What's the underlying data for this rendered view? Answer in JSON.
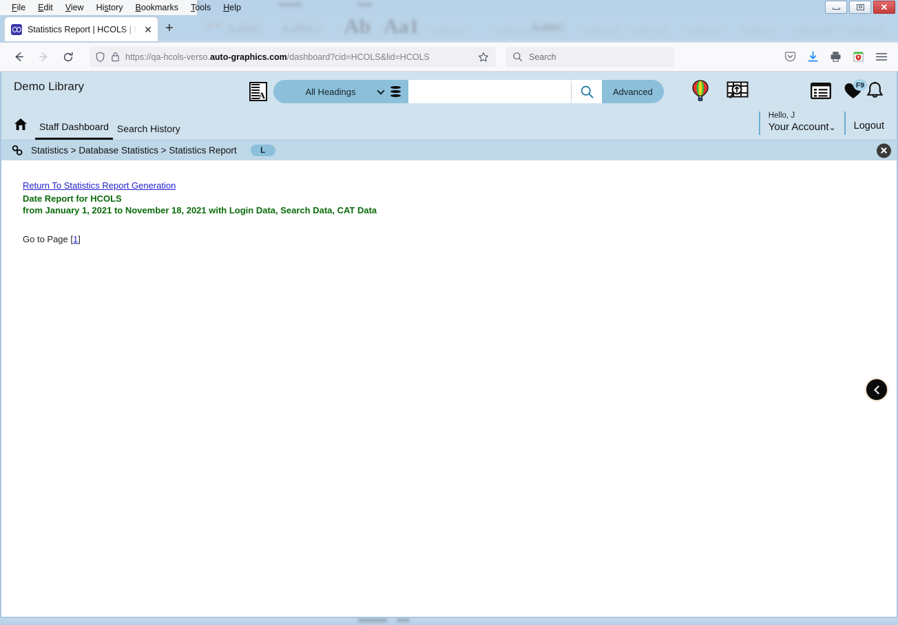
{
  "window": {
    "menus": [
      "File",
      "Edit",
      "View",
      "History",
      "Bookmarks",
      "Tools",
      "Help"
    ],
    "minimize_label": "–",
    "maximize_label": "□",
    "close_label": "✕"
  },
  "browser": {
    "tab": {
      "title": "Statistics Report | HCOLS | hcols",
      "favicon": "hcols-favicon",
      "close_label": "✕"
    },
    "new_tab_label": "+",
    "back_icon": "back-arrow-icon",
    "forward_icon": "forward-arrow-icon",
    "reload_icon": "reload-icon",
    "url": {
      "prefix": "https://qa-hcols-verso.",
      "host": "auto-graphics.com",
      "suffix": "/dashboard?cid=HCOLS&lid=HCOLS",
      "shield_icon": "shield-icon",
      "lock_icon": "lock-icon",
      "bookmark_icon": "star-outline-icon"
    },
    "search": {
      "placeholder": "Search",
      "icon": "search-icon"
    },
    "toolbar_icons": [
      "pocket-icon",
      "download-icon",
      "print-icon",
      "extension-icon",
      "hamburger-menu-icon"
    ]
  },
  "app": {
    "brand": "Demo Library",
    "search": {
      "language_icon": "language-translate-icon",
      "scope_selected": "All Headings",
      "scope_chevron": "chevron-down-icon",
      "database_icon": "database-icon",
      "query_value": "",
      "query_placeholder": "",
      "search_icon": "search-icon",
      "advanced_label": "Advanced"
    },
    "header_icons": [
      "hot-air-balloon-icon",
      "map-search-icon",
      "list-view-icon",
      "favorites-heart-icon",
      "notification-bell-icon"
    ],
    "favorites_badge": "F9",
    "account": {
      "greeting": "Hello, J",
      "menu_label": "Your Account",
      "chevron": "chevron-down-icon",
      "logout_label": "Logout"
    },
    "nav": {
      "home_icon": "home-icon",
      "tabs": [
        {
          "label": "Staff Dashboard",
          "active": true
        },
        {
          "label": "Search History",
          "active": false
        }
      ]
    },
    "breadcrumb": {
      "link_icon": "chain-link-icon",
      "text": "Statistics > Database Statistics > Statistics Report",
      "badge": "L",
      "close_icon": "close-circle-icon"
    },
    "content": {
      "return_link": "Return To Statistics Report Generation",
      "report_title": "Date Report for HCOLS",
      "report_range": "from January 1, 2021 to November 18, 2021 with Login Data, Search Data, CAT Data",
      "pager_prefix": "Go to Page [",
      "pager_page": "1",
      "pager_suffix": "]"
    },
    "collapse_icon": "chevron-left-circle-icon"
  },
  "colors": {
    "app_header_bg": "#cfe2ee",
    "accent_blue": "#8cc0da",
    "breadcrumb_bg": "#bfd8e8",
    "link": "#2020cc",
    "report_green": "#0a6b0a",
    "page_border": "#a9c6e0"
  }
}
